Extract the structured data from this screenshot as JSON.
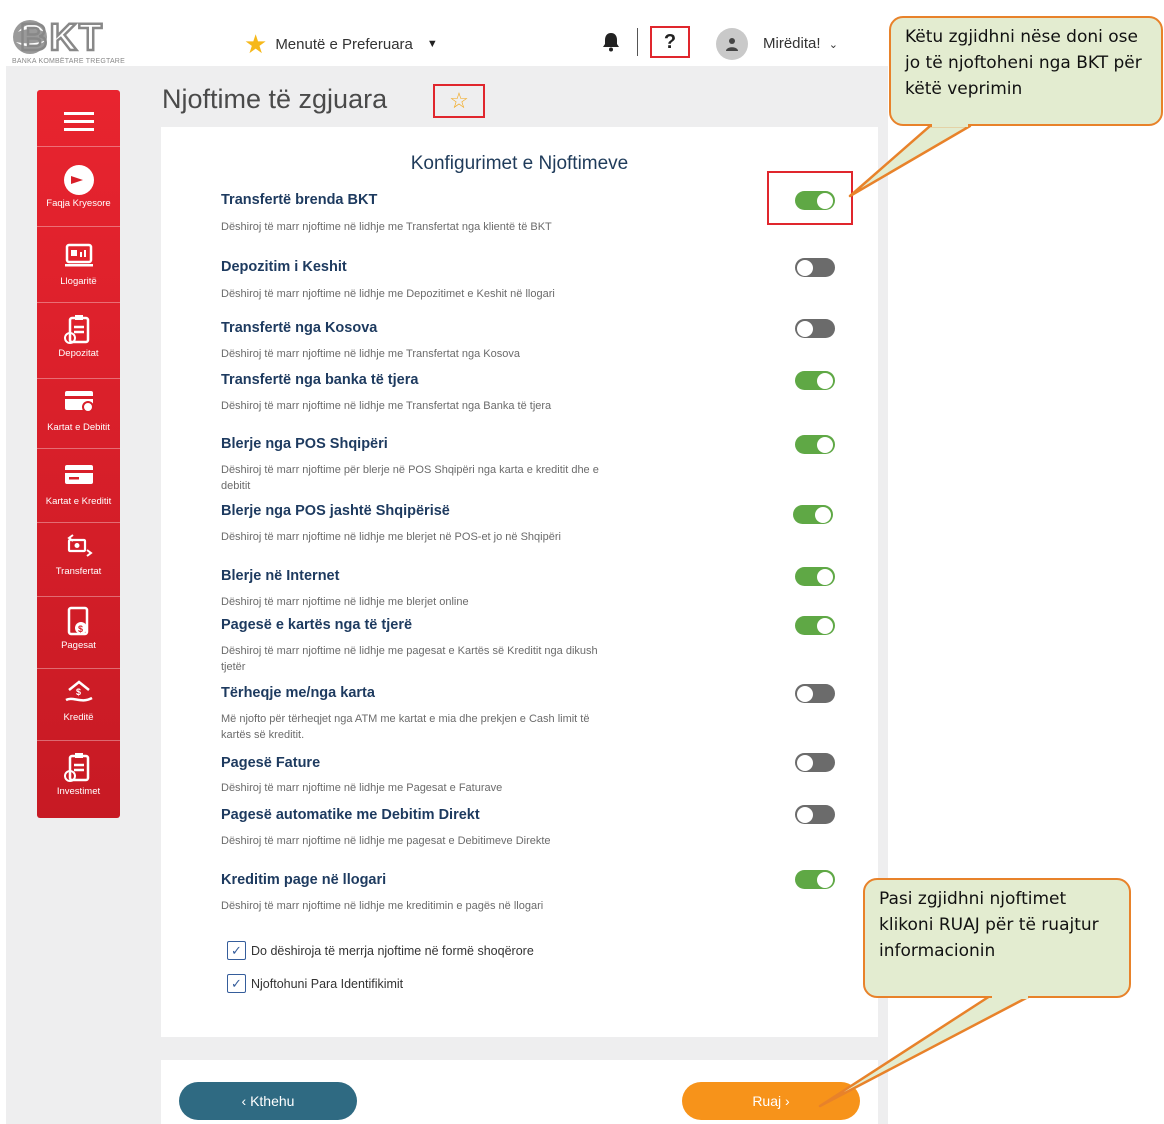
{
  "header": {
    "logo_text": "BKT",
    "logo_subtitle": "BANKA KOMBËTARE TREGTARE",
    "favorites_label": "Menutë e Preferuara",
    "help_label": "?",
    "greeting": "Mirëdita!"
  },
  "sidebar": {
    "items": [
      {
        "label": "Faqja Kryesore",
        "icon": "home-icon"
      },
      {
        "label": "Llogaritë",
        "icon": "accounts-icon"
      },
      {
        "label": "Depozitat",
        "icon": "deposits-icon"
      },
      {
        "label": "Kartat e Debitit",
        "icon": "debit-card-icon"
      },
      {
        "label": "Kartat e Kreditit",
        "icon": "credit-card-icon"
      },
      {
        "label": "Transfertat",
        "icon": "transfer-icon"
      },
      {
        "label": "Pagesat",
        "icon": "payments-icon"
      },
      {
        "label": "Kreditë",
        "icon": "loans-icon"
      },
      {
        "label": "Investimet",
        "icon": "investments-icon"
      }
    ]
  },
  "page": {
    "title": "Njoftime të zgjuara"
  },
  "card": {
    "title": "Konfigurimet e Njoftimeve",
    "rows": [
      {
        "title": "Transfertë brenda BKT",
        "desc": "Dëshiroj të marr njoftime në lidhje me Transfertat nga klientë të BKT",
        "on": true
      },
      {
        "title": "Depozitim i Keshit",
        "desc": "Dëshiroj të marr njoftime në lidhje me Depozitimet e Keshit në llogari",
        "on": false
      },
      {
        "title": "Transfertë nga Kosova",
        "desc": "Dëshiroj të marr njoftime në lidhje me Transfertat nga Kosova",
        "on": false
      },
      {
        "title": "Transfertë nga banka të tjera",
        "desc": "Dëshiroj të marr njoftime në lidhje me Transfertat nga Banka të tjera",
        "on": true
      },
      {
        "title": "Blerje nga POS Shqipëri",
        "desc": "Dëshiroj të marr njoftime për blerje në POS Shqipëri nga karta e kreditit dhe e debitit",
        "on": true
      },
      {
        "title": "Blerje nga POS jashtë Shqipërisë",
        "desc": "Dëshiroj të marr njoftime në lidhje me blerjet në POS-et jo në Shqipëri",
        "on": true
      },
      {
        "title": "Blerje në Internet",
        "desc": "Dëshiroj të marr njoftime në lidhje me blerjet online",
        "on": true
      },
      {
        "title": "Pagesë e kartës nga të tjerë",
        "desc": "Dëshiroj të marr njoftime në lidhje me pagesat e Kartës së Kreditit nga dikush tjetër",
        "on": true
      },
      {
        "title": "Tërheqje me/nga karta",
        "desc": "Më njofto për tërheqjet nga ATM me kartat e mia dhe prekjen e Cash limit të kartës së kreditit.",
        "on": false
      },
      {
        "title": "Pagesë Fature",
        "desc": "Dëshiroj të marr njoftime në lidhje me Pagesat e Faturave",
        "on": false
      },
      {
        "title": "Pagesë automatike me Debitim Direkt",
        "desc": "Dëshiroj të marr njoftime në lidhje me pagesat e Debitimeve Direkte",
        "on": false
      },
      {
        "title": "Kreditim page në llogari",
        "desc": "Dëshiroj të marr njoftime në lidhje me kreditimin e pagës në llogari",
        "on": true
      }
    ],
    "checkbox_social": "Do dëshiroja të merrja njoftime në formë shoqërore",
    "checkbox_pre_auth": "Njoftohuni Para Identifikimit"
  },
  "buttons": {
    "back": "‹  Kthehu",
    "save": "Ruaj  ›"
  },
  "callouts": {
    "toggle_hint": "Këtu zgjidhni nëse doni ose jo të njoftoheni nga BKT për këtë veprimin",
    "save_hint": "Pasi zgjidhni njoftimet klikoni RUAJ për të ruajtur informacionin"
  },
  "colors": {
    "brand_red": "#e0262d",
    "toggle_on": "#5fa845",
    "toggle_off": "#6b6b6b",
    "save_button": "#f7931a",
    "back_button": "#2f6a82"
  }
}
